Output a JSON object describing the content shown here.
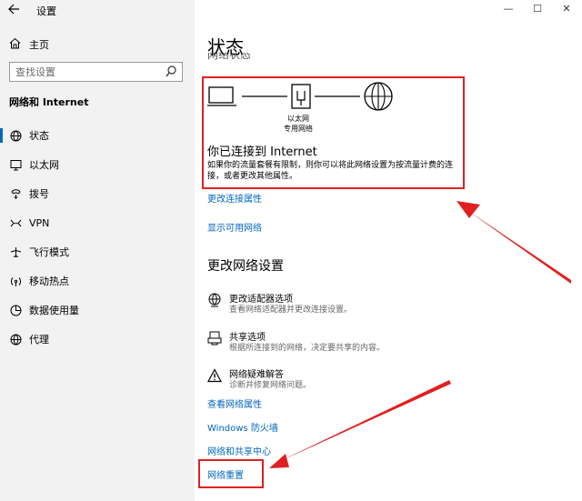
{
  "window": {
    "app_title": "设置",
    "back_icon": "arrow-left-icon",
    "controls": {
      "minimize": "—",
      "maximize": "☐",
      "close": "✕"
    }
  },
  "sidebar": {
    "home_label": "主页",
    "search_placeholder": "查找设置",
    "section_title": "网络和 Internet",
    "items": [
      {
        "label": "状态",
        "icon": "globe-status-icon",
        "active": true
      },
      {
        "label": "以太网",
        "icon": "ethernet-monitor-icon"
      },
      {
        "label": "拨号",
        "icon": "phone-icon"
      },
      {
        "label": "VPN",
        "icon": "vpn-icon"
      },
      {
        "label": "飞行模式",
        "icon": "airplane-icon"
      },
      {
        "label": "移动热点",
        "icon": "hotspot-icon"
      },
      {
        "label": "数据使用量",
        "icon": "data-usage-icon"
      },
      {
        "label": "代理",
        "icon": "proxy-globe-icon"
      }
    ]
  },
  "main": {
    "page_title": "状态",
    "clipped_heading": "网络状态",
    "diagram": {
      "adapter_label_line1": "以太网",
      "adapter_label_line2": "专用网络"
    },
    "connected_title": "你已连接到 Internet",
    "connected_desc": "如果你的流量套餐有限制，则你可以将此网络设置为按流量计费的连接，或者更改其他属性。",
    "links_top": [
      "更改连接属性",
      "显示可用网络"
    ],
    "change_settings_title": "更改网络设置",
    "settings": [
      {
        "title": "更改适配器选项",
        "desc": "查看网络适配器并更改连接设置。",
        "icon": "adapter-globe-icon"
      },
      {
        "title": "共享选项",
        "desc": "根据所连接到的网络，决定要共享的内容。",
        "icon": "sharing-icon"
      },
      {
        "title": "网络疑难解答",
        "desc": "诊断并修复网络问题。",
        "icon": "warning-icon"
      }
    ],
    "links_bottom": [
      "查看网络属性",
      "Windows 防火墙",
      "网络和共享中心",
      "网络重置"
    ]
  },
  "colors": {
    "accent": "#0067c0",
    "annotation": "#e02020",
    "sidebar_bg": "#f2f2f2"
  }
}
